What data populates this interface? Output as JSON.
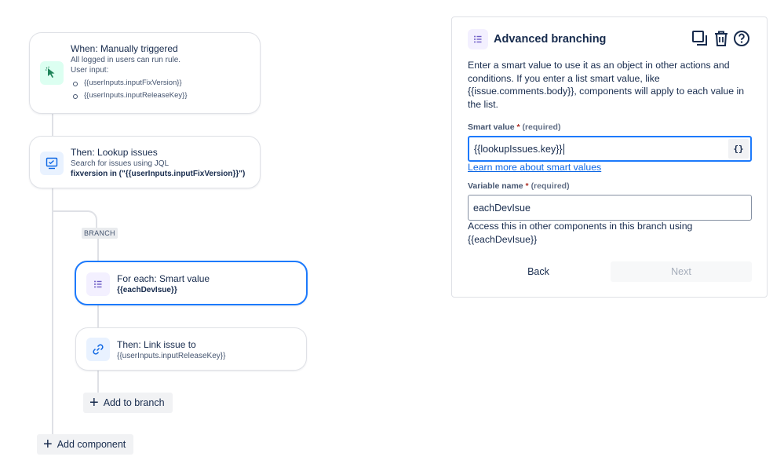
{
  "flow": {
    "trigger": {
      "title": "When: Manually triggered",
      "line1": "All logged in users can run rule.",
      "line2": "User input:",
      "inputs": [
        "{{userInputs.inputFixVersion}}",
        "{{userInputs.inputReleaseKey}}"
      ]
    },
    "lookup": {
      "title": "Then: Lookup issues",
      "line1": "Search for issues using JQL",
      "line2": "fixversion in (\"{{userInputs.inputFixVersion}}\")"
    },
    "branch_badge": "BRANCH",
    "foreach": {
      "title": "For each: Smart value",
      "line1": "{{eachDevIsue}}"
    },
    "link": {
      "title": "Then: Link issue to",
      "line1": "{{userInputs.inputReleaseKey}}"
    },
    "add_to_branch": "Add to branch",
    "add_component": "Add component"
  },
  "panel": {
    "title": "Advanced branching",
    "description": "Enter a smart value to use it as an object in other actions and conditions. If you enter a list smart value, like {{issue.comments.body}}, components will apply to each value in the list.",
    "smart_value": {
      "label": "Smart value",
      "required_mark": "*",
      "required_text": "(required)",
      "value": "{{lookupIssues.key}}",
      "button": "{}"
    },
    "learn_more": "Learn more about smart values",
    "variable_name": {
      "label": "Variable name",
      "required_mark": "*",
      "required_text": "(required)",
      "value": "eachDevIsue"
    },
    "helper": "Access this in other components in this branch using {{eachDevIsue}}",
    "back": "Back",
    "next": "Next"
  },
  "colors": {
    "accent": "#1d7afc",
    "trigger_tile": "#dcfff1",
    "lookup_tile": "#e9f2ff",
    "branch_tile": "#f3f0ff"
  }
}
